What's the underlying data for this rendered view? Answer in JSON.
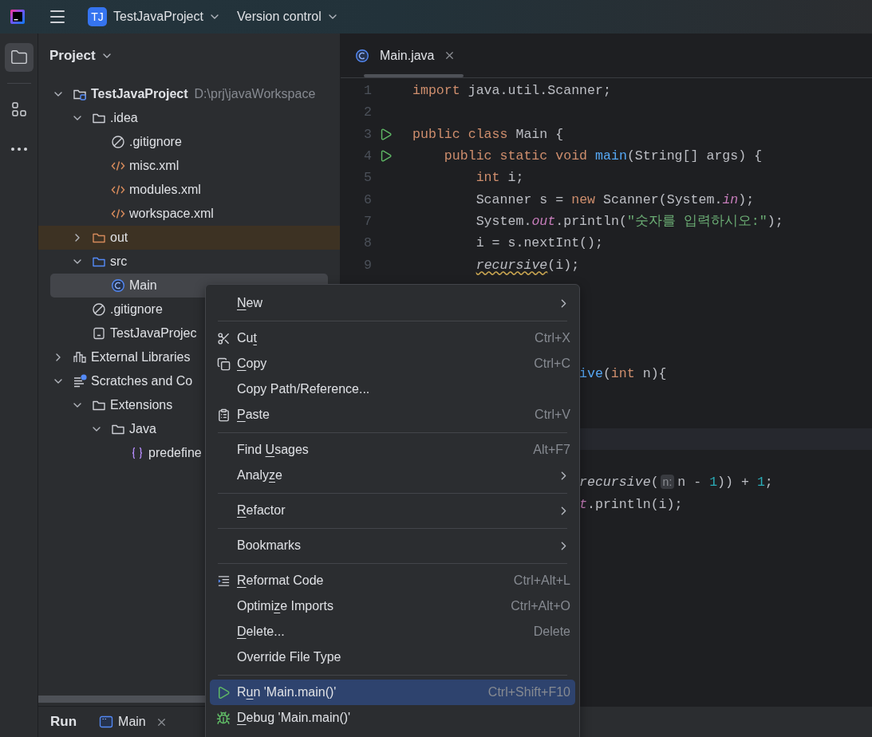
{
  "title_bar": {
    "project_badge": "TJ",
    "project_name": "TestJavaProject",
    "version_control": "Version control"
  },
  "tool_strip": [
    {
      "kind": "project",
      "selected": true
    },
    {
      "kind": "structure",
      "selected": false
    },
    {
      "kind": "more",
      "selected": false
    }
  ],
  "project_panel": {
    "title": "Project",
    "tree": [
      {
        "label": "TestJavaProject",
        "path": "D:\\prj\\javaWorkspace",
        "kind": "project",
        "expanded": true,
        "selected": false,
        "children": [
          {
            "label": ".idea",
            "kind": "folder",
            "expanded": true,
            "selected": false,
            "children": [
              {
                "label": ".gitignore",
                "kind": "ignore",
                "selected": false
              },
              {
                "label": "misc.xml",
                "kind": "xml",
                "selected": false
              },
              {
                "label": "modules.xml",
                "kind": "xml",
                "selected": false
              },
              {
                "label": "workspace.xml",
                "kind": "xml",
                "selected": false
              }
            ]
          },
          {
            "label": "out",
            "kind": "excluded_folder",
            "expanded": false,
            "selected": false
          },
          {
            "label": "src",
            "kind": "source_folder",
            "expanded": true,
            "selected": false,
            "children": [
              {
                "label": "Main",
                "kind": "class",
                "selected": true
              }
            ]
          },
          {
            "label": ".gitignore",
            "kind": "ignore",
            "selected": false
          },
          {
            "label": "TestJavaProjec",
            "kind": "module",
            "selected": false
          }
        ]
      },
      {
        "label": "External Libraries",
        "kind": "libraries",
        "expanded": false,
        "selected": false
      },
      {
        "label": "Scratches and Co",
        "kind": "scratches",
        "expanded": true,
        "selected": false,
        "children": [
          {
            "label": "Extensions",
            "kind": "folder",
            "expanded": true,
            "selected": false,
            "children": [
              {
                "label": "Java",
                "kind": "folder",
                "expanded": true,
                "selected": false,
                "children": [
                  {
                    "label": "predefine",
                    "kind": "braces",
                    "selected": false
                  }
                ]
              }
            ]
          }
        ]
      }
    ]
  },
  "editor": {
    "tabs": [
      {
        "label": "Main.java",
        "selected": true
      }
    ],
    "lines": [
      {
        "number": "1",
        "run": false,
        "current": false,
        "tokens": [
          {
            "t": "import",
            "kind": "keyword"
          },
          {
            "t": " java.util.Scanner;",
            "kind": "plain"
          }
        ]
      },
      {
        "number": "2",
        "run": false,
        "current": false
      },
      {
        "number": "3",
        "run": true,
        "current": false,
        "tokens": [
          {
            "t": "public class",
            "kind": "keyword"
          },
          {
            "t": " Main {",
            "kind": "plain"
          }
        ]
      },
      {
        "number": "4",
        "run": true,
        "current": false,
        "tokens": [
          {
            "t": "    public static void",
            "kind": "keyword"
          },
          {
            "t": " main",
            "kind": "method"
          },
          {
            "t": "(String[] args) {",
            "kind": "plain"
          }
        ]
      },
      {
        "number": "5",
        "run": false,
        "current": false,
        "tokens": [
          {
            "t": "        int",
            "kind": "keyword"
          },
          {
            "t": " i;",
            "kind": "plain"
          }
        ]
      },
      {
        "number": "6",
        "run": false,
        "current": false,
        "tokens": [
          {
            "t": "        Scanner s = ",
            "kind": "plain"
          },
          {
            "t": "new",
            "kind": "keyword"
          },
          {
            "t": " Scanner(System.",
            "kind": "plain"
          },
          {
            "t": "in",
            "kind": "field"
          },
          {
            "t": ");",
            "kind": "plain"
          }
        ]
      },
      {
        "number": "7",
        "run": false,
        "current": false,
        "tokens": [
          {
            "t": "        System.",
            "kind": "plain"
          },
          {
            "t": "out",
            "kind": "field"
          },
          {
            "t": ".println(",
            "kind": "plain"
          },
          {
            "t": "\"숫자를 입력하시오:\"",
            "kind": "string"
          },
          {
            "t": ");",
            "kind": "plain"
          }
        ]
      },
      {
        "number": "8",
        "run": false,
        "current": false,
        "tokens": [
          {
            "t": "        i = s.nextInt();",
            "kind": "plain"
          }
        ]
      },
      {
        "number": "9",
        "run": false,
        "current": false,
        "tokens": [
          {
            "t": "        recursive",
            "kind": "warning"
          },
          {
            "t": "(i);",
            "kind": "plain"
          }
        ]
      },
      {
        "current": false
      },
      {
        "current": false
      },
      {
        "current": false
      },
      {
        "current": false
      },
      {
        "current": false,
        "partial": true,
        "tokens": [
          {
            "t": "ive",
            "kind": "method"
          },
          {
            "t": "(",
            "kind": "plain"
          },
          {
            "t": "int",
            "kind": "keyword"
          },
          {
            "t": " n){",
            "kind": "plain"
          }
        ]
      },
      {
        "current": false
      },
      {
        "current": false
      },
      {
        "current": true
      },
      {
        "current": false
      },
      {
        "current": false,
        "partial": true,
        "tokens": [
          {
            "t": "recursive",
            "kind": "call"
          },
          {
            "t": "(",
            "kind": "plain"
          },
          {
            "t": "n:",
            "kind": "hint"
          },
          {
            "t": "n - ",
            "kind": "plain"
          },
          {
            "t": "1",
            "kind": "number"
          },
          {
            "t": ")) + ",
            "kind": "plain"
          },
          {
            "t": "1",
            "kind": "number"
          },
          {
            "t": ";",
            "kind": "plain"
          }
        ]
      },
      {
        "current": false,
        "partial": true,
        "tokens": [
          {
            "t": "t",
            "kind": "field"
          },
          {
            "t": ".println(i);",
            "kind": "plain"
          }
        ]
      }
    ]
  },
  "context_menu": [
    {
      "kind": "plain",
      "label": [
        {
          "t": "N",
          "underline": true
        },
        {
          "t": "ew",
          "underline": false
        }
      ],
      "submenu": true,
      "selected": false
    },
    {
      "kind": "separator"
    },
    {
      "kind": "cut",
      "label": [
        {
          "t": "Cu",
          "underline": false
        },
        {
          "t": "t",
          "underline": true
        }
      ],
      "shortcut": "Ctrl+X",
      "submenu": false,
      "selected": false
    },
    {
      "kind": "copy",
      "label": [
        {
          "t": "C",
          "underline": true
        },
        {
          "t": "opy",
          "underline": false
        }
      ],
      "shortcut": "Ctrl+C",
      "submenu": false,
      "selected": false
    },
    {
      "kind": "plain",
      "label": [
        {
          "t": "Copy Path/Reference...",
          "underline": false
        }
      ],
      "submenu": false,
      "selected": false
    },
    {
      "kind": "paste",
      "label": [
        {
          "t": "P",
          "underline": true
        },
        {
          "t": "aste",
          "underline": false
        }
      ],
      "shortcut": "Ctrl+V",
      "submenu": false,
      "selected": false
    },
    {
      "kind": "separator"
    },
    {
      "kind": "plain",
      "label": [
        {
          "t": "Find ",
          "underline": false
        },
        {
          "t": "U",
          "underline": true
        },
        {
          "t": "sages",
          "underline": false
        }
      ],
      "shortcut": "Alt+F7",
      "submenu": false,
      "selected": false
    },
    {
      "kind": "plain",
      "label": [
        {
          "t": "Analy",
          "underline": false
        },
        {
          "t": "z",
          "underline": true
        },
        {
          "t": "e",
          "underline": false
        }
      ],
      "submenu": true,
      "selected": false
    },
    {
      "kind": "separator"
    },
    {
      "kind": "plain",
      "label": [
        {
          "t": "R",
          "underline": true
        },
        {
          "t": "efactor",
          "underline": false
        }
      ],
      "submenu": true,
      "selected": false
    },
    {
      "kind": "separator"
    },
    {
      "kind": "plain",
      "label": [
        {
          "t": "Bookmarks",
          "underline": false
        }
      ],
      "submenu": true,
      "selected": false
    },
    {
      "kind": "separator"
    },
    {
      "kind": "reformat",
      "label": [
        {
          "t": "R",
          "underline": true
        },
        {
          "t": "eformat Code",
          "underline": false
        }
      ],
      "shortcut": "Ctrl+Alt+L",
      "submenu": false,
      "selected": false
    },
    {
      "kind": "plain",
      "label": [
        {
          "t": "Optimi",
          "underline": false
        },
        {
          "t": "z",
          "underline": true
        },
        {
          "t": "e Imports",
          "underline": false
        }
      ],
      "shortcut": "Ctrl+Alt+O",
      "submenu": false,
      "selected": false
    },
    {
      "kind": "plain",
      "label": [
        {
          "t": "D",
          "underline": true
        },
        {
          "t": "elete...",
          "underline": false
        }
      ],
      "shortcut": "Delete",
      "submenu": false,
      "selected": false
    },
    {
      "kind": "plain",
      "label": [
        {
          "t": "Override File Type",
          "underline": false
        }
      ],
      "submenu": false,
      "selected": false
    },
    {
      "kind": "separator"
    },
    {
      "kind": "run",
      "label": [
        {
          "t": "R",
          "underline": false
        },
        {
          "t": "u",
          "underline": true
        },
        {
          "t": "n 'Main.main()'",
          "underline": false
        }
      ],
      "shortcut": "Ctrl+Shift+F10",
      "submenu": false,
      "selected": true
    },
    {
      "kind": "debug",
      "label": [
        {
          "t": "D",
          "underline": true
        },
        {
          "t": "ebug 'Main.main()'",
          "underline": false
        }
      ],
      "submenu": false,
      "selected": false
    }
  ],
  "bottom_panel": {
    "title": "Run",
    "tabs": [
      {
        "label": "Main",
        "selected": false
      }
    ]
  }
}
